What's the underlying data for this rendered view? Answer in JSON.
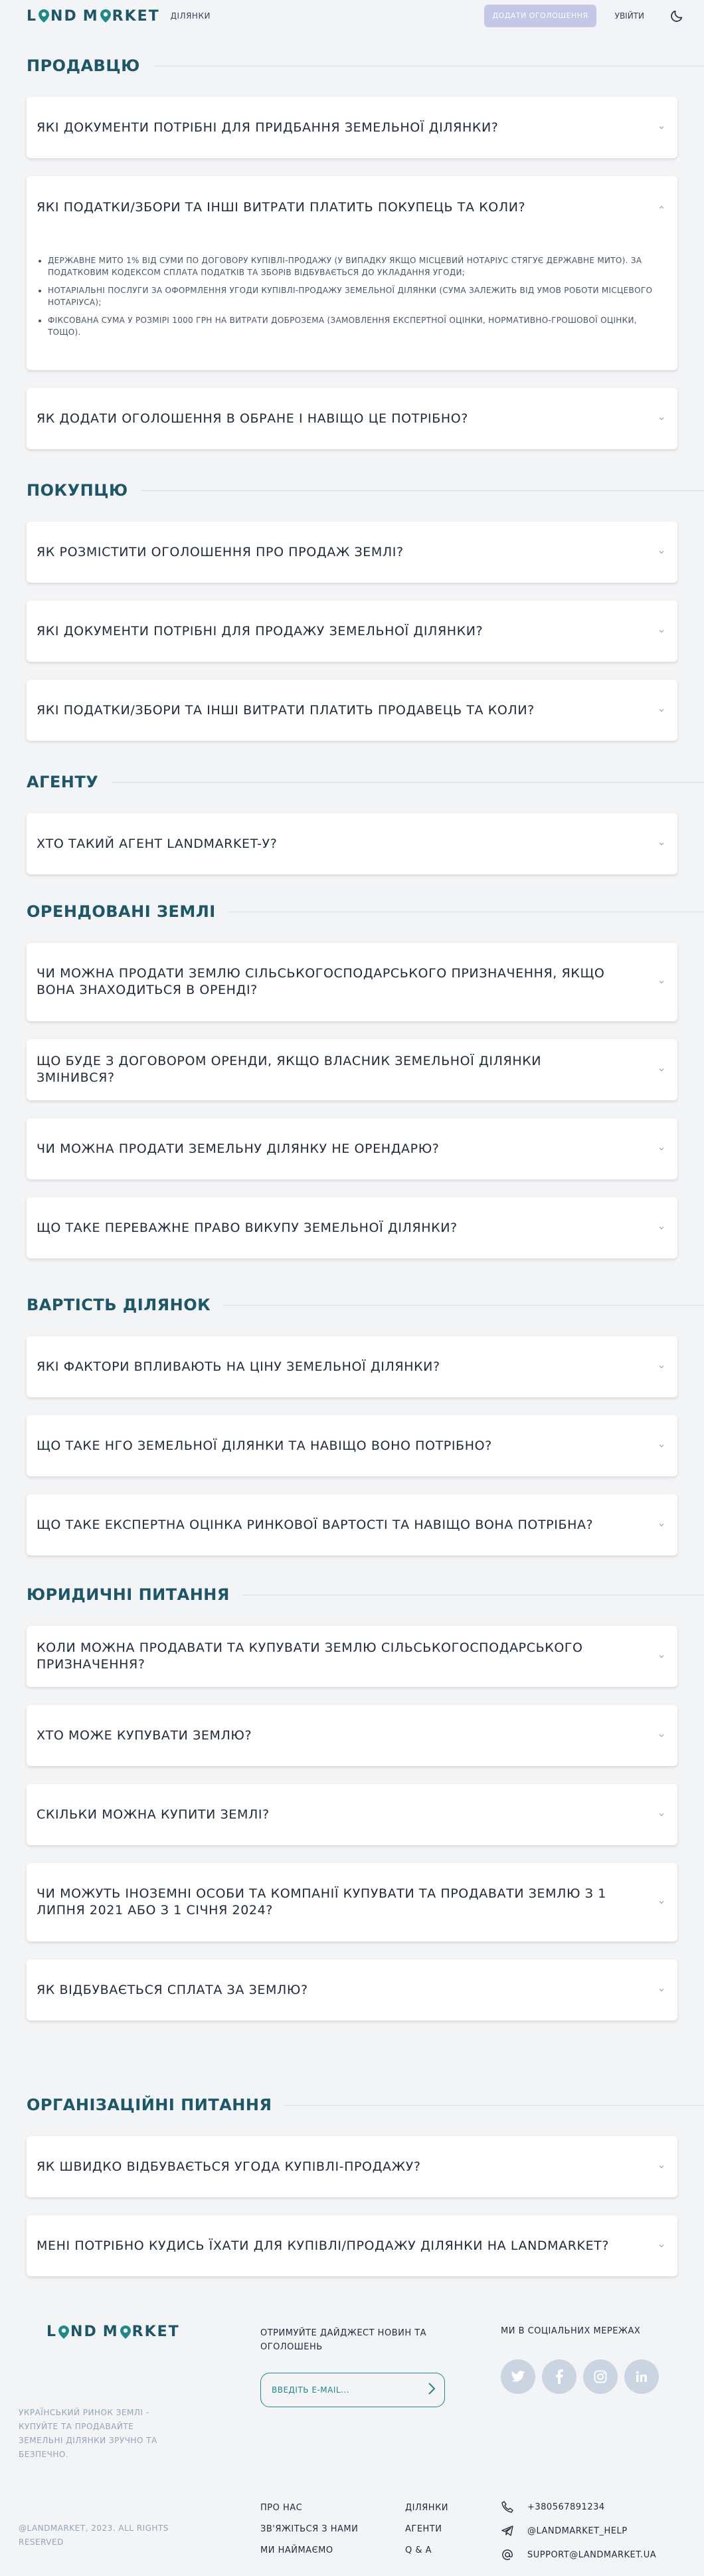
{
  "header": {
    "logo": "LAND MARKET",
    "nav_plots": "ДІЛЯНКИ",
    "add_listing": "ДОДАТИ ОГОЛОШЕННЯ",
    "login": "УВІЙТИ"
  },
  "sections": [
    {
      "title": "ПРОДАВЦЮ",
      "items": [
        {
          "q": "ЯКІ ДОКУМЕНТИ ПОТРІБНІ ДЛЯ ПРИДБАННЯ ЗЕМЕЛЬНОЇ ДІЛЯНКИ?"
        },
        {
          "q": "ЯКІ ПОДАТКИ/ЗБОРИ ТА ІНШІ ВИТРАТИ ПЛАТИТЬ ПОКУПЕЦЬ ТА КОЛИ?",
          "open": true,
          "answer": [
            "ДЕРЖАВНЕ МИТО 1% ВІД СУМИ ПО ДОГОВОРУ КУПІВЛІ-ПРОДАЖУ (У ВИПАДКУ ЯКЩО МІСЦЕВИЙ НОТАРІУС СТЯГУЄ ДЕРЖАВНЕ МИТО). ЗА ПОДАТКОВИМ КОДЕКСОМ СПЛАТА ПОДАТКІВ ТА ЗБОРІВ ВІДБУВАЄТЬСЯ ДО УКЛАДАННЯ УГОДИ;",
            "НОТАРІАЛЬНІ ПОСЛУГИ ЗА ОФОРМЛЕННЯ УГОДИ КУПІВЛІ-ПРОДАЖУ ЗЕМЕЛЬНОЇ ДІЛЯНКИ (СУМА ЗАЛЕЖИТЬ ВІД УМОВ РОБОТИ МІСЦЕВОГО НОТАРІУСА);",
            "ФІКСОВАНА СУМА У РОЗМІРІ 1000 ГРН НА ВИТРАТИ ДОБРОЗЕМА (ЗАМОВЛЕННЯ ЕКСПЕРТНОЇ ОЦІНКИ, НОРМАТИВНО-ГРОШОВОЇ ОЦІНКИ, ТОЩО)."
          ]
        },
        {
          "q": "ЯК ДОДАТИ ОГОЛОШЕННЯ В ОБРАНЕ І НАВІЩО ЦЕ ПОТРІБНО?"
        }
      ]
    },
    {
      "title": "ПОКУПЦЮ",
      "items": [
        {
          "q": "ЯК РОЗМІСТИТИ ОГОЛОШЕННЯ ПРО ПРОДАЖ ЗЕМЛІ?"
        },
        {
          "q": "ЯКІ ДОКУМЕНТИ ПОТРІБНІ ДЛЯ ПРОДАЖУ ЗЕМЕЛЬНОЇ ДІЛЯНКИ?"
        },
        {
          "q": "ЯКІ ПОДАТКИ/ЗБОРИ ТА ІНШІ ВИТРАТИ ПЛАТИТЬ ПРОДАВЕЦЬ ТА КОЛИ?"
        }
      ]
    },
    {
      "title": "АГЕНТУ",
      "items": [
        {
          "q": "ХТО ТАКИЙ АГЕНТ LANDMARKET-У?"
        }
      ]
    },
    {
      "title": "ОРЕНДОВАНІ ЗЕМЛІ",
      "items": [
        {
          "q": "ЧИ МОЖНА ПРОДАТИ ЗЕМЛЮ СІЛЬСЬКОГОСПОДАРСЬКОГО ПРИЗНАЧЕННЯ, ЯКЩО ВОНА ЗНАХОДИТЬСЯ В ОРЕНДІ?"
        },
        {
          "q": "ЩО БУДЕ З ДОГОВОРОМ ОРЕНДИ, ЯКЩО ВЛАСНИК ЗЕМЕЛЬНОЇ ДІЛЯНКИ ЗМІНИВСЯ?"
        },
        {
          "q": "ЧИ МОЖНА ПРОДАТИ ЗЕМЕЛЬНУ ДІЛЯНКУ НЕ ОРЕНДАРЮ?"
        },
        {
          "q": "ЩО ТАКЕ ПЕРЕВАЖНЕ ПРАВО ВИКУПУ ЗЕМЕЛЬНОЇ ДІЛЯНКИ?"
        }
      ]
    },
    {
      "title": "ВАРТІСТЬ ДІЛЯНОК",
      "items": [
        {
          "q": "ЯКІ ФАКТОРИ ВПЛИВАЮТЬ НА ЦІНУ ЗЕМЕЛЬНОЇ ДІЛЯНКИ?"
        },
        {
          "q": "ЩО ТАКЕ НГО ЗЕМЕЛЬНОЇ ДІЛЯНКИ ТА НАВІЩО ВОНО ПОТРІБНО?"
        },
        {
          "q": "ЩО ТАКЕ ЕКСПЕРТНА ОЦІНКА РИНКОВОЇ ВАРТОСТІ ТА НАВІЩО ВОНА ПОТРІБНА?"
        }
      ]
    },
    {
      "title": "ЮРИДИЧНІ ПИТАННЯ",
      "items": [
        {
          "q": "КОЛИ МОЖНА ПРОДАВАТИ ТА КУПУВАТИ ЗЕМЛЮ СІЛЬСЬКОГОСПОДАРСЬКОГО ПРИЗНАЧЕННЯ?"
        },
        {
          "q": "ХТО МОЖЕ КУПУВАТИ ЗЕМЛЮ?"
        },
        {
          "q": "СКІЛЬКИ МОЖНА КУПИТИ ЗЕМЛІ?"
        },
        {
          "q": "ЧИ МОЖУТЬ ІНОЗЕМНІ ОСОБИ ТА КОМПАНІЇ КУПУВАТИ ТА ПРОДАВАТИ ЗЕМЛЮ З 1 ЛИПНЯ 2021 АБО З 1 СІЧНЯ 2024?"
        },
        {
          "q": "ЯК ВІДБУВАЄТЬСЯ СПЛАТА ЗА ЗЕМЛЮ?"
        }
      ]
    },
    {
      "title": "ОРГАНІЗАЦІЙНІ ПИТАННЯ",
      "items": [
        {
          "q": "ЯК ШВИДКО ВІДБУВАЄТЬСЯ УГОДА КУПІВЛІ-ПРОДАЖУ?"
        },
        {
          "q": "МЕНІ ПОТРІБНО КУДИСЬ ЇХАТИ ДЛЯ КУПІВЛІ/ПРОДАЖУ ДІЛЯНКИ НА LANDMARKET?"
        }
      ]
    }
  ],
  "footer": {
    "logo": "LAND MARKET",
    "description": "УКРАЇНСЬКИЙ РИНОК ЗЕМЛІ - КУПУЙТЕ ТА ПРОДАВАЙТЕ ЗЕМЕЛЬНІ ДІЛЯНКИ ЗРУЧНО ТА БЕЗПЕЧНО.",
    "copyright": "@LANDMARKET, 2023. ALL RIGHTS RESERVED",
    "digest": "ОТРИМУЙТЕ ДАЙДЖЕСТ НОВИН ТА ОГОЛОШЕНЬ",
    "email_placeholder": "ВВЕДІТЬ E-MAIL...",
    "social_title": "МИ В СОЦІАЛЬНИХ МЕРЕЖАХ",
    "socials": [
      "twitter-icon",
      "facebook-icon",
      "instagram-icon",
      "linkedin-icon"
    ],
    "links": [
      "ПРО НАС",
      "ДІЛЯНКИ",
      "ЗВ'ЯЖІТЬСЯ З НАМИ",
      "АГЕНТИ",
      "МИ НАЙМАЄМО",
      "Q & A"
    ],
    "phone": "+380567891234",
    "telegram": "@LANDMARKET_HELP",
    "email": "SUPPORT@LANDMARKET.UA"
  },
  "colors": {
    "brand": "#1c5669",
    "accent": "#1c8a8a",
    "button": "#c4c7e8"
  }
}
